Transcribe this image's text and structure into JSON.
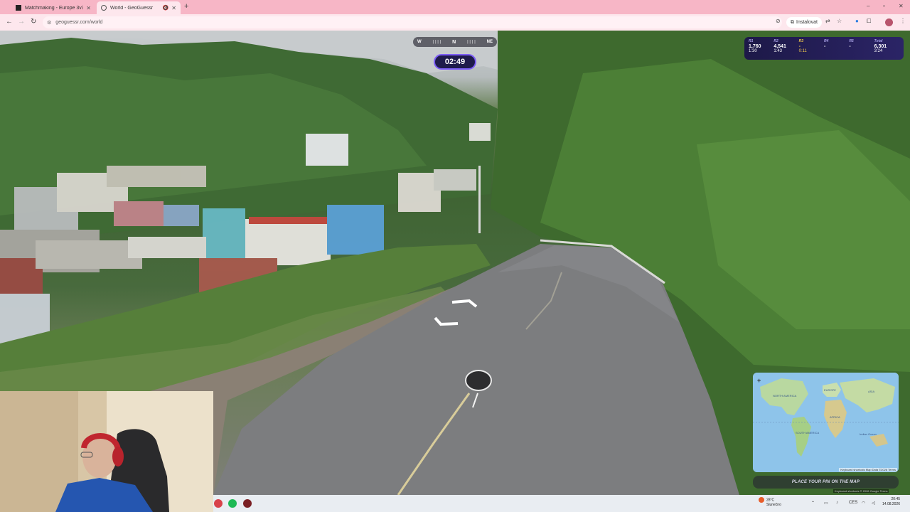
{
  "browser": {
    "tabs": [
      {
        "title": "Matchmaking - Europe 3v3 Co",
        "close": "✕"
      },
      {
        "title": "World - GeoGuessr",
        "close": "✕",
        "active": true
      }
    ],
    "new_tab": "+",
    "url": "geoguessr.com/world",
    "install_label": "Instalovat",
    "window_controls": {
      "minimize": "–",
      "maximize": "▫",
      "close": "✕"
    }
  },
  "game": {
    "compass": {
      "left": "W",
      "center": "N",
      "right": "NE"
    },
    "timer": "02:49",
    "scoreboard": [
      {
        "label": "R1",
        "score": "1,760",
        "time": "1:30"
      },
      {
        "label": "R2",
        "score": "4,541",
        "time": "1:43"
      },
      {
        "label": "R3",
        "score": "-",
        "time": "0:11",
        "active": true
      },
      {
        "label": "R4",
        "score": "-",
        "time": ""
      },
      {
        "label": "R5",
        "score": "-",
        "time": ""
      },
      {
        "label": "Total",
        "score": "6,301",
        "time": "3:24"
      }
    ],
    "map": {
      "zoom": "+",
      "labels": {
        "north_america": "NORTH AMERICA",
        "south_america": "SOUTH AMERICA",
        "asia": "ASIA",
        "africa": "AFRICA",
        "europe": "EUROPE",
        "indian_ocean": "Indian Ocean"
      },
      "attribution": "Keyboard shortcuts   Map Data ©2026   Terms"
    },
    "place_pin_label": "PLACE YOUR PIN ON THE MAP",
    "keyboard_shortcuts": "Keyboard shortcuts  © 2026 Google  Terms"
  },
  "taskbar": {
    "weather_temp": "28°C",
    "weather_desc": "Slunečno",
    "lang": "CES",
    "time": "20:45",
    "date": "14.08.2026"
  }
}
